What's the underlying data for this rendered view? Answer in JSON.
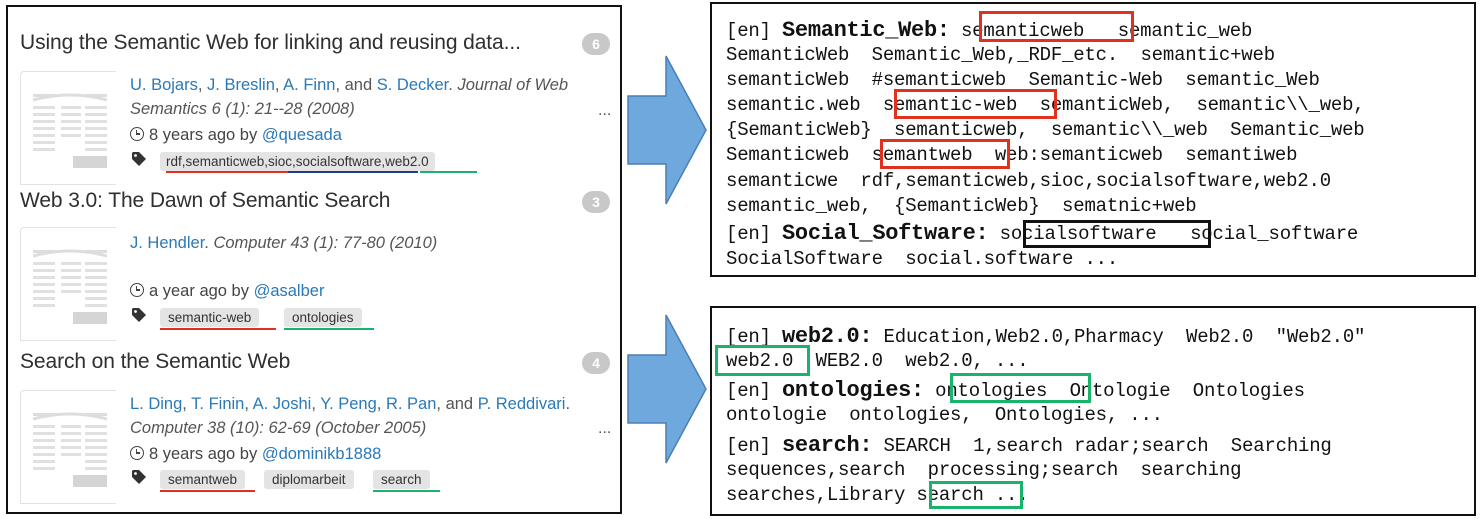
{
  "entries": [
    {
      "title": "Using the Semantic Web for linking and reusing data...",
      "count": "6",
      "authors": [
        "U. Bojars",
        "J. Breslin",
        "A. Finn",
        "S. Decker"
      ],
      "venue_line1": "Journal of Web",
      "venue_line2": "Semantics 6 (1): 21--28 (2008)",
      "more": "...",
      "time": "8 years ago by",
      "user": "@quesada",
      "tags": [
        "rdf,semanticweb,sioc,socialsoftware,web2.0"
      ]
    },
    {
      "title": "Web 3.0: The Dawn of Semantic Search",
      "count": "3",
      "authors": [
        "J. Hendler"
      ],
      "venue_line1": "Computer 43 (1): 77-80 (2010)",
      "time": "a year ago by",
      "user": "@asalber",
      "tags": [
        "semantic-web",
        "ontologies"
      ]
    },
    {
      "title": "Search on the Semantic Web",
      "count": "4",
      "authors": [
        "L. Ding",
        "T. Finin",
        "A. Joshi",
        "Y. Peng",
        "R. Pan",
        "P. Reddivari"
      ],
      "venue_line1": "Computer 38 (10): 62-69 (October 2005)",
      "more": "...",
      "time": "8 years ago by",
      "user": "@dominikb1888",
      "tags": [
        "semantweb",
        "diplomarbeit",
        "search"
      ]
    }
  ],
  "colors": {
    "red": "#e0301e",
    "blue": "#1f3c88",
    "green": "#19b36b",
    "black": "#111111",
    "arrow": "#6fa8dc"
  },
  "top_box": {
    "lines": [
      [
        "[en] ",
        "Semantic_Web:",
        " semanticweb   semantic_web"
      ],
      [
        "SemanticWeb  Semantic_Web,_RDF_etc.  semantic+web"
      ],
      [
        "semanticWeb  #semanticweb  Semantic-Web  semantic_Web"
      ],
      [
        "semantic.web  semantic-web  semanticWeb,  semantic\\\\_web,"
      ],
      [
        "{SemanticWeb}  semanticweb,  semantic\\\\_web  Semantic_web"
      ],
      [
        "Semanticweb  semantweb  web:semanticweb  semantiweb"
      ],
      [
        "semanticwe  rdf,semanticweb,sioc,socialsoftware,web2.0"
      ],
      [
        "semantic_web,  {SemanticWeb}  sematnic+web"
      ],
      [
        "[en] ",
        "Social_Software:",
        " socialsoftware   social_software"
      ],
      [
        "SocialSoftware  social.software ..."
      ]
    ]
  },
  "bottom_box": {
    "lines": [
      [
        "[en] ",
        "web2.0:",
        " Education,Web2.0,Pharmacy  Web2.0  \"Web2.0\""
      ],
      [
        "web2.0  WEB2.0  web2.0, ..."
      ],
      [
        "[en] ",
        "ontologies:",
        " ontologies  Ontologie  Ontologies"
      ],
      [
        "ontologie  ontologies,  Ontologies, ..."
      ],
      [
        "[en] ",
        "search:",
        " SEARCH  1,search radar;search  Searching"
      ],
      [
        "sequences,search  processing;search  searching"
      ],
      [
        "searches,Library search ..."
      ]
    ]
  }
}
